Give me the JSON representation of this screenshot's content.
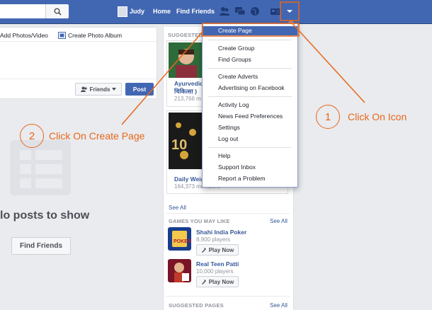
{
  "topbar": {
    "user_name": "Judy",
    "home_label": "Home",
    "find_friends_label": "Find Friends"
  },
  "composer": {
    "add_photos_label": "Add Photos/Video",
    "create_album_label": "Create Photo Album",
    "audience_label": "Friends",
    "post_label": "Post"
  },
  "feed": {
    "empty_label": "lo posts to show",
    "find_friends_button": "Find Friends"
  },
  "suggested": {
    "header": "SUGGESTED",
    "card1_title": "Ayurvedic",
    "card1_title2": "चिकित्सा )",
    "card1_members": "213,766 m",
    "card2_title": "Daily Weig",
    "card2_members": "164,373 members",
    "see_all": "See All"
  },
  "games": {
    "header": "GAMES YOU MAY LIKE",
    "see_all": "See All",
    "items": [
      {
        "title": "Shahi India Poker",
        "players": "8,900 players",
        "action": "Play Now"
      },
      {
        "title": "Real Teen Patti",
        "players": "10,000 players",
        "action": "Play Now"
      }
    ]
  },
  "suggested_pages": {
    "header": "SUGGESTED PAGES",
    "see_all": "See All"
  },
  "dropdown": {
    "items": [
      "Create Page",
      "Create Group",
      "Find Groups",
      "Create Adverts",
      "Advertising on Facebook",
      "Activity Log",
      "News Feed Preferences",
      "Settings",
      "Log out",
      "Help",
      "Support Inbox",
      "Report a Problem"
    ]
  },
  "annotations": {
    "step1_number": "1",
    "step1_text": "Click On Icon",
    "step2_number": "2",
    "step2_text": "Click On Create Page",
    "color": "#e8671b"
  },
  "colors": {
    "brand": "#4267b2",
    "link": "#365899",
    "background": "#e9ebee"
  }
}
